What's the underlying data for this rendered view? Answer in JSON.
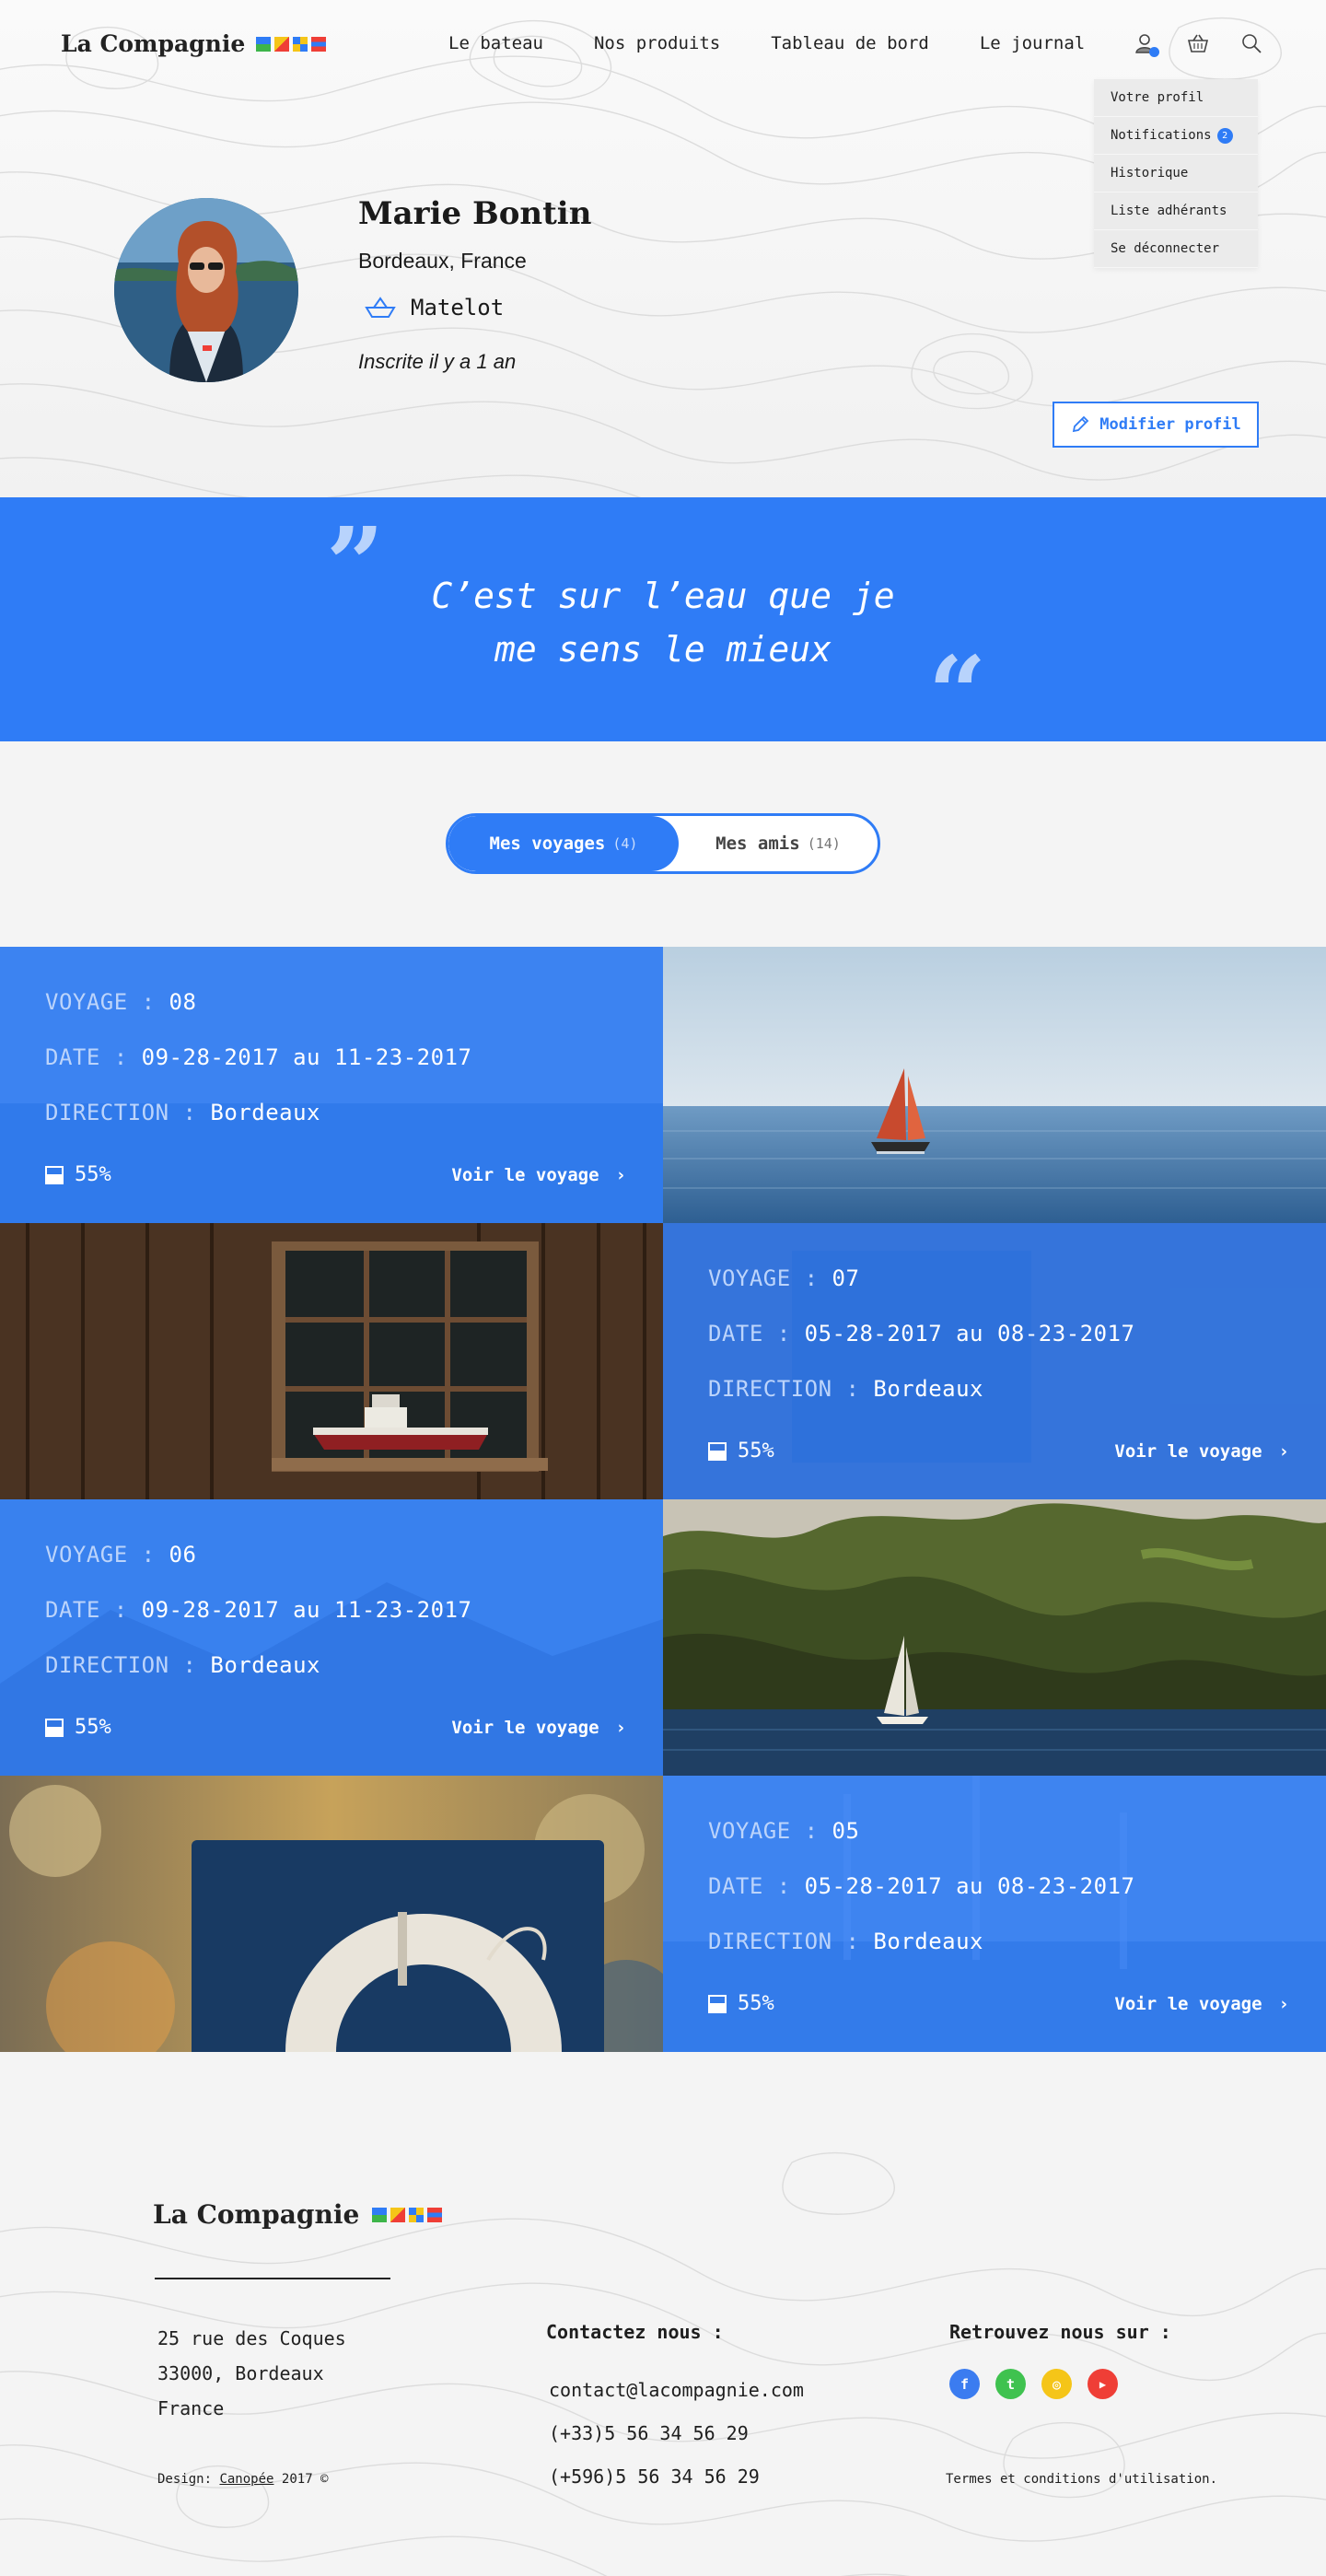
{
  "brand": {
    "name": "La Compagnie",
    "accent": "#2f7cf6"
  },
  "nav": {
    "links": [
      "Le bateau",
      "Nos produits",
      "Tableau de bord",
      "Le journal"
    ],
    "icons": [
      "user-icon",
      "basket-icon",
      "search-icon"
    ]
  },
  "user_menu": {
    "items": [
      "Votre profil",
      "Notifications",
      "Historique",
      "Liste adhérants",
      "Se déconnecter"
    ],
    "notifications_count": "2"
  },
  "profile": {
    "name": "Marie Bontin",
    "city": "Bordeaux, France",
    "rank": "Matelot",
    "since": "Inscrite il y a 1 an",
    "edit_label": "Modifier profil"
  },
  "quote": {
    "text_line1": "C’est sur l’eau que je",
    "text_line2": "me sens le mieux",
    "open_mark": "”",
    "close_mark": "“"
  },
  "tabs": [
    {
      "label": "Mes voyages",
      "count": "(4)",
      "active": true
    },
    {
      "label": "Mes amis",
      "count": "(14)",
      "active": false
    }
  ],
  "trips": [
    {
      "voyage_label": "VOYAGE :",
      "voyage": "08",
      "date_label": "DATE :",
      "date": "09-28-2017 au 11-23-2017",
      "direction_label": "DIRECTION :",
      "direction": "Bordeaux",
      "progress": "55%",
      "progress_value": 0.55,
      "cta": "Voir le voyage"
    },
    {
      "voyage_label": "VOYAGE :",
      "voyage": "07",
      "date_label": "DATE :",
      "date": "05-28-2017 au 08-23-2017",
      "direction_label": "DIRECTION :",
      "direction": "Bordeaux",
      "progress": "55%",
      "progress_value": 0.55,
      "cta": "Voir le voyage"
    },
    {
      "voyage_label": "VOYAGE :",
      "voyage": "06",
      "date_label": "DATE :",
      "date": "09-28-2017 au 11-23-2017",
      "direction_label": "DIRECTION :",
      "direction": "Bordeaux",
      "progress": "55%",
      "progress_value": 0.55,
      "cta": "Voir le voyage"
    },
    {
      "voyage_label": "VOYAGE :",
      "voyage": "05",
      "date_label": "DATE :",
      "date": "05-28-2017 au 08-23-2017",
      "direction_label": "DIRECTION :",
      "direction": "Bordeaux",
      "progress": "55%",
      "progress_value": 0.55,
      "cta": "Voir le voyage"
    }
  ],
  "footer": {
    "brand": "La Compagnie",
    "address": [
      "25 rue des Coques",
      "33000, Bordeaux",
      "France"
    ],
    "contact_title": "Contactez nous :",
    "contact": [
      "contact@lacompagnie.com",
      "(+33)5 56 34 56 29",
      "(+596)5 56 34 56 29"
    ],
    "social_title": "Retrouvez nous sur :",
    "socials": [
      {
        "name": "facebook-icon",
        "glyph": "f",
        "color": "#3b7cf0"
      },
      {
        "name": "twitter-icon",
        "glyph": "t",
        "color": "#3fc24f"
      },
      {
        "name": "instagram-icon",
        "glyph": "◎",
        "color": "#f5c518"
      },
      {
        "name": "youtube-icon",
        "glyph": "▶",
        "color": "#ef3e36"
      }
    ],
    "design_prefix": "Design:",
    "design_link": "Canopée",
    "design_suffix": "2017 ©",
    "terms": "Termes et conditions d'utilisation."
  }
}
